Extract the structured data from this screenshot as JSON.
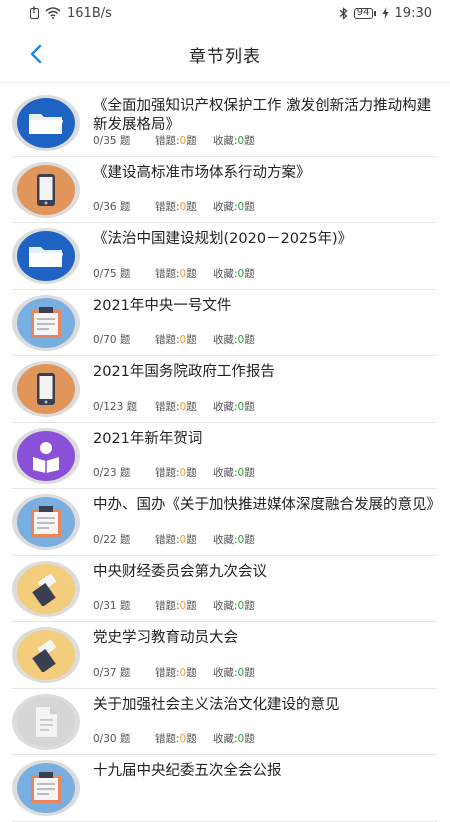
{
  "status_bar": {
    "speed": "161B/s",
    "battery": "94",
    "time": "19:30"
  },
  "header": {
    "title": "章节列表"
  },
  "labels": {
    "questions_suffix": " 题",
    "wrong_label": "错题:",
    "fav_label": "收藏:",
    "unit": "题"
  },
  "colors": {
    "accent_blue": "#1a8ae6",
    "wrong_count": "#f0a030",
    "fav_count": "#28a040"
  },
  "items": [
    {
      "title": "《全面加强知识产权保护工作 激发创新活力推动构建新发展格局》",
      "progress": "0/35",
      "wrong": "0",
      "fav": "0",
      "icon": "folder-icon"
    },
    {
      "title": "《建设高标准市场体系行动方案》",
      "progress": "0/36",
      "wrong": "0",
      "fav": "0",
      "icon": "phone-icon"
    },
    {
      "title": "《法治中国建设规划(2020－2025年)》",
      "progress": "0/75",
      "wrong": "0",
      "fav": "0",
      "icon": "folder-icon"
    },
    {
      "title": "2021年中央一号文件",
      "progress": "0/70",
      "wrong": "0",
      "fav": "0",
      "icon": "clipboard-icon"
    },
    {
      "title": "2021年国务院政府工作报告",
      "progress": "0/123",
      "wrong": "0",
      "fav": "0",
      "icon": "phone-icon"
    },
    {
      "title": "2021年新年贺词",
      "progress": "0/23",
      "wrong": "0",
      "fav": "0",
      "icon": "reader-icon"
    },
    {
      "title": "中办、国办《关于加快推进媒体深度融合发展的意见》",
      "progress": "0/22",
      "wrong": "0",
      "fav": "0",
      "icon": "clipboard-icon"
    },
    {
      "title": "中央财经委员会第九次会议",
      "progress": "0/31",
      "wrong": "0",
      "fav": "0",
      "icon": "stamp-icon"
    },
    {
      "title": "党史学习教育动员大会",
      "progress": "0/37",
      "wrong": "0",
      "fav": "0",
      "icon": "stamp-icon"
    },
    {
      "title": "关于加强社会主义法治文化建设的意见",
      "progress": "0/30",
      "wrong": "0",
      "fav": "0",
      "icon": "document-icon"
    },
    {
      "title": "十九届中央纪委五次全会公报",
      "progress": "",
      "wrong": "",
      "fav": "",
      "icon": "clipboard-icon"
    }
  ]
}
